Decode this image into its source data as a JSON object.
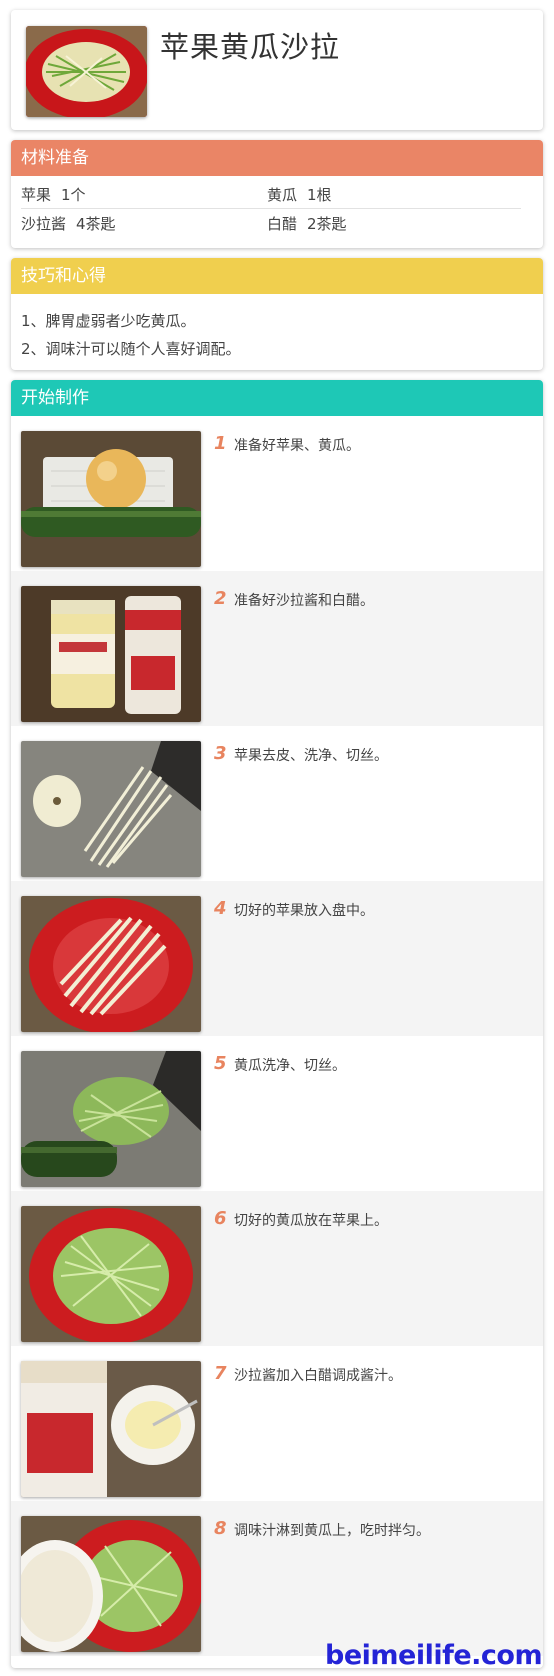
{
  "recipe": {
    "title": "苹果黄瓜沙拉"
  },
  "ingredients": {
    "header": "材料准备",
    "items": [
      {
        "name": "苹果",
        "amount": "1个"
      },
      {
        "name": "黄瓜",
        "amount": "1根"
      },
      {
        "name": "沙拉酱",
        "amount": "4茶匙"
      },
      {
        "name": "白醋",
        "amount": "2茶匙"
      }
    ]
  },
  "tips": {
    "header": "技巧和心得",
    "items": [
      "1、脾胃虚弱者少吃黄瓜。",
      "2、调味汁可以随个人喜好调配。"
    ]
  },
  "steps": {
    "header": "开始制作",
    "items": [
      {
        "num": "1",
        "text": "准备好苹果、黄瓜。"
      },
      {
        "num": "2",
        "text": "准备好沙拉酱和白醋。"
      },
      {
        "num": "3",
        "text": "苹果去皮、洗净、切丝。"
      },
      {
        "num": "4",
        "text": "切好的苹果放入盘中。"
      },
      {
        "num": "5",
        "text": "黄瓜洗净、切丝。"
      },
      {
        "num": "6",
        "text": "切好的黄瓜放在苹果上。"
      },
      {
        "num": "7",
        "text": "沙拉酱加入白醋调成酱汁。"
      },
      {
        "num": "8",
        "text": "调味汁淋到黄瓜上，吃时拌匀。"
      }
    ]
  },
  "watermark": "beimeilife.com",
  "colors": {
    "ingredients_header": "#ea8566",
    "tips_header": "#f0cf4e",
    "steps_header": "#1ec8b6",
    "step_number": "#e8845f",
    "watermark": "#2424d6"
  }
}
